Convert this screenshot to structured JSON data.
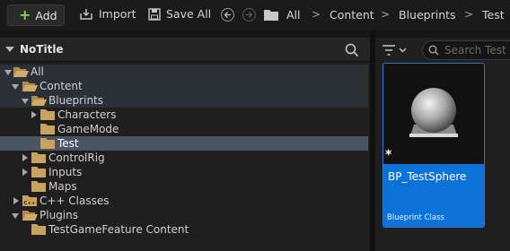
{
  "toolbar": {
    "add_label": "Add",
    "import_label": "Import",
    "save_all_label": "Save All"
  },
  "breadcrumbs": [
    "All",
    "Content",
    "Blueprints",
    "Test"
  ],
  "left_panel": {
    "title": "NoTitle"
  },
  "tree": {
    "all": "All",
    "content": "Content",
    "blueprints": "Blueprints",
    "characters": "Characters",
    "gamemode": "GameMode",
    "test": "Test",
    "controlrig": "ControlRig",
    "inputs": "Inputs",
    "maps": "Maps",
    "cpp_classes": "C++ Classes",
    "plugins": "Plugins",
    "testgamefeature": "TestGameFeature Content"
  },
  "right_panel": {
    "search_placeholder": "Search Test"
  },
  "asset": {
    "name": "BP_TestSphere",
    "type": "Blueprint Class",
    "asterisk": "*"
  },
  "colors": {
    "accent": "#0d72d8",
    "selected_row": "#4a5563",
    "folder": "#c9a25e",
    "add_plus": "#7ad14a"
  }
}
